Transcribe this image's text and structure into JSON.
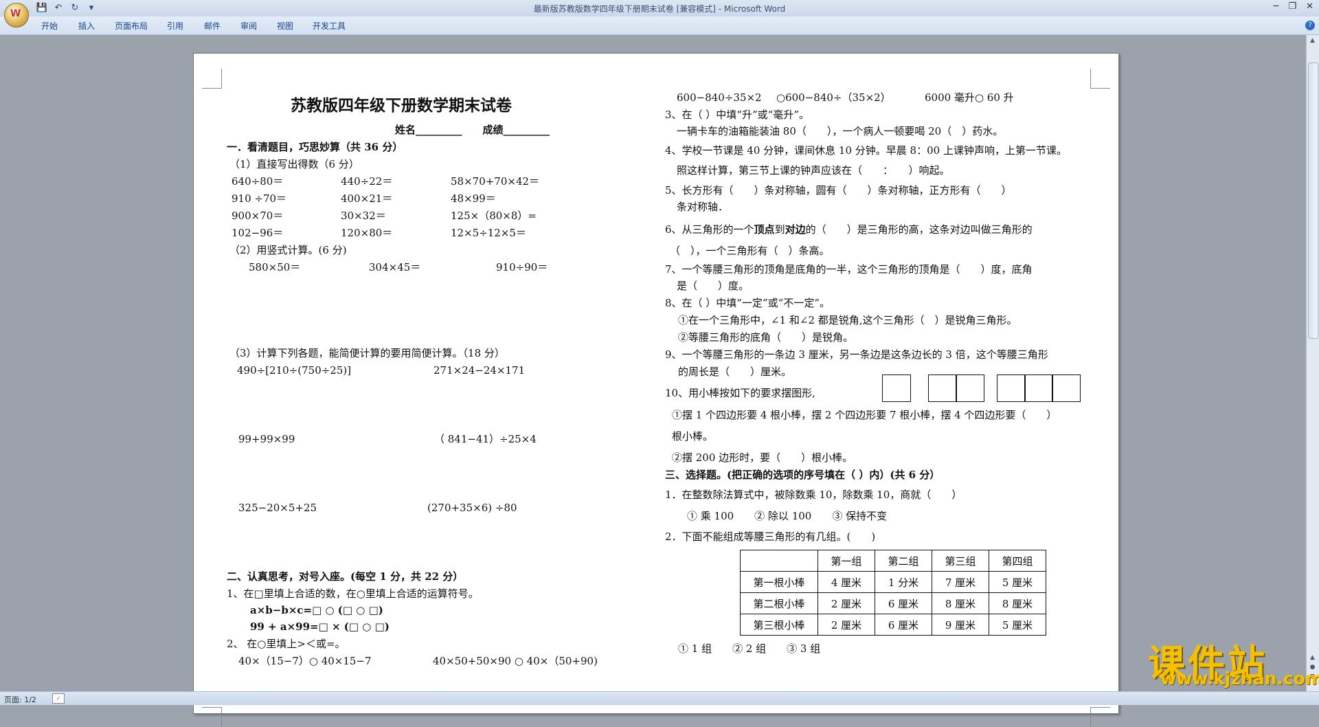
{
  "window": {
    "title": "最新版苏教版数学四年级下册期末试卷 [兼容模式] - Microsoft Word",
    "office_button_label": "W",
    "minimize": "─",
    "restore": "❐",
    "close": "✕",
    "help": "?"
  },
  "ribbon": {
    "tabs": [
      "开始",
      "插入",
      "页面布局",
      "引用",
      "邮件",
      "审阅",
      "视图",
      "开发工具"
    ]
  },
  "status": {
    "pages": "页面: 1/2"
  },
  "doc": {
    "title": "苏教版四年级下册数学期末试卷",
    "name_score_line": "姓名_________　　成绩_________",
    "s1_heading": "一．看清题目，巧思妙算（共 36 分）",
    "s1_p1": "（1）直接写出得数（6 分）",
    "s1_calc": [
      [
        "640÷80＝",
        "440÷22＝",
        "58×70+70×42＝"
      ],
      [
        "910 ÷70＝",
        "400×21＝",
        "48×99＝"
      ],
      [
        "900×70＝",
        "30×32＝",
        "125×（80×8）="
      ],
      [
        "102−96＝",
        "120×80＝",
        "12×5÷12×5＝"
      ]
    ],
    "s1_p2": "（2）用竖式计算。(6 分)",
    "s1_vertical": [
      "580×50＝",
      "304×45＝",
      "910÷90＝"
    ],
    "s1_p3": "（3）计算下列各题，能简便计算的要用简便计算。（18 分）",
    "s1_simplify": [
      "490÷[210÷(750÷25)]",
      "271×24−24×171",
      "99+99×99",
      "（ 841−41）÷25×4",
      "325−20×5+25",
      "(270+35×6) ÷80"
    ],
    "s2_heading": "二、认真思考，对号入座。(每空 1 分，共 22 分）",
    "s2_q1": "1、在□里填上合适的数，在○里填上合适的运算符号。",
    "s2_q1_a": "a×b−b×c=□ ○ (□ ○ □)",
    "s2_q1_b": "99 + a×99=□ × (□ ○ □)",
    "s2_q2": "2、 在○里填上>＜或=。",
    "s2_q2_a": "40×（15−7）○ 40×15−7",
    "s2_q2_b": "40×50+50×90 ○ 40×（50+90)",
    "r_cmp_a": "600−840÷35×2",
    "r_cmp_b": "○600−840÷（35×2）",
    "r_cmp_c": "6000 毫升○ 60 升",
    "q3": "3、在（ ）中填“升”或“毫升”。",
    "q3_text": "一辆卡车的油箱能装油 80（　　），一个病人一顿要喝 20（　）药水。",
    "q4": "4、学校一节课是 40 分钟，课间休息 10 分钟。早晨 8：00 上课钟声响，上第一节课。",
    "q4_b": "照这样计算，第三节上课的钟声应该在（　　：　　）响起。",
    "q5": "5、长方形有（　　）条对称轴，圆有（　　）条对称轴，正方形有（　　）",
    "q5_b": "条对称轴．",
    "q6_pre": "6、从三角形的一个",
    "q6_bold1": "顶点",
    "q6_mid": "到",
    "q6_bold2": "对边",
    "q6_post": "的（　　）是三角形的高，这条对边叫做三角形的",
    "q6_b": "（　），一个三角形有（　）条高。",
    "q7": "7、一个等腰三角形的顶角是底角的一半，这个三角形的顶角是（　　）度，底角",
    "q7_b": "是（　　）度。",
    "q8": "8、在（ ）中填“一定”或“不一定”。",
    "q8_1": "①在一个三角形中，∠1 和∠2 都是锐角,这个三角形（　）是锐角三角形。",
    "q8_2": "②等腰三角形的底角（　　）是锐角。",
    "q9": "9、一个等腰三角形的一条边 3 厘米，另一条边是这条边长的 3 倍，这个等腰三角形",
    "q9_b": "的周长是（　　）厘米。",
    "q10": "10、用小棒按如下的要求摆图形,",
    "q10_1": "①摆 1 个四边形要 4 根小棒，摆 2 个四边形要 7 根小棒，摆 4 个四边形要（　　）",
    "q10_1b": "根小棒。",
    "q10_2": "②摆 200 边形时，要（　　）根小棒。",
    "s3_heading": "三、选择题。(把正确的选项的序号填在（ ）内）(共 6 分）",
    "s3_q1": "1．在整数除法算式中，被除数乘 10，除数乘 10，商就（　　）",
    "s3_q1_opts": "① 乘 100　　② 除以 100　　③ 保持不变",
    "s3_q2": "2．下面不能组成等腰三角形的有几组。(　　)",
    "table_header": [
      "",
      "第一组",
      "第二组",
      "第三组",
      "第四组"
    ],
    "table_rows": [
      [
        "第一根小棒",
        "4 厘米",
        "1 分米",
        "7 厘米",
        "5 厘米"
      ],
      [
        "第二根小棒",
        "2 厘米",
        "6 厘米",
        "8 厘米",
        "8 厘米"
      ],
      [
        "第三根小棒",
        "2 厘米",
        "6 厘米",
        "9 厘米",
        "5 厘米"
      ]
    ],
    "s3_q2_opts": "① 1 组　　② 2 组　　③ 3 组"
  },
  "watermark": {
    "brand": "课件站",
    "url": "www.kjzhan.com"
  }
}
